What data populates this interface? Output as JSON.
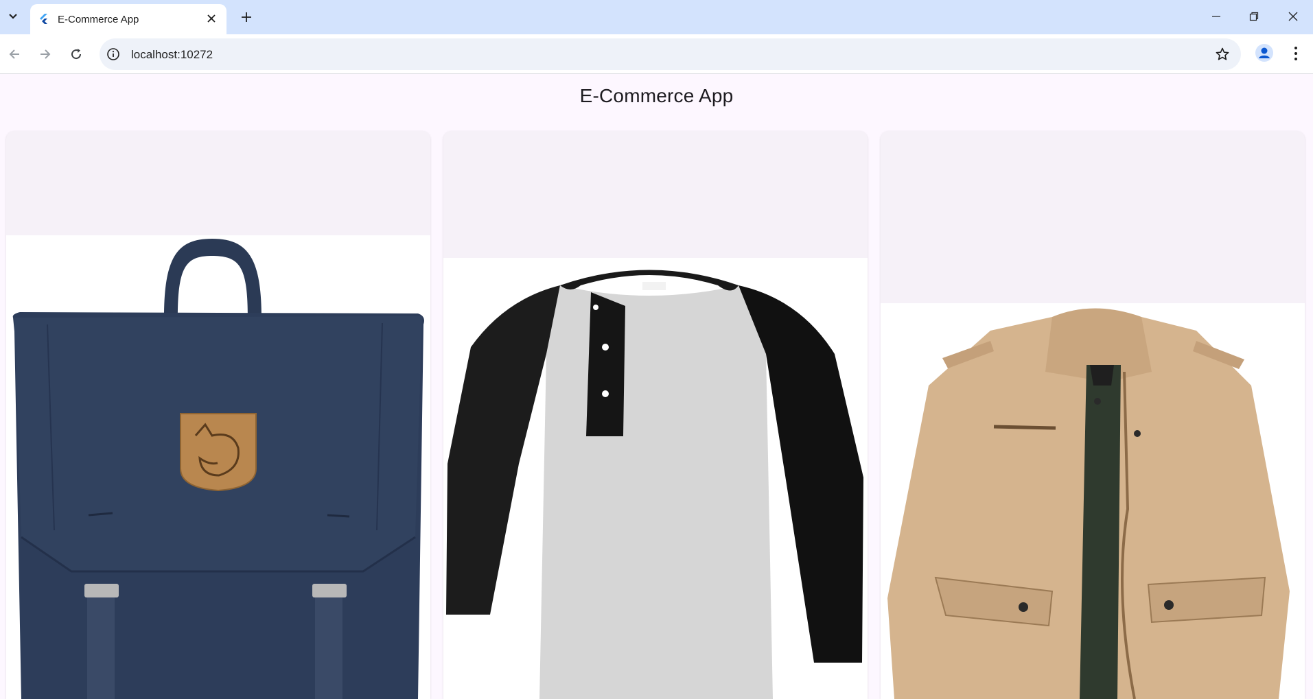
{
  "browser": {
    "tab_title": "E-Commerce App",
    "url": "localhost:10272"
  },
  "app": {
    "title": "E-Commerce App"
  },
  "products": [
    {
      "name": "backpack",
      "icon": "backpack-image"
    },
    {
      "name": "raglan-henley-shirt",
      "icon": "shirt-image"
    },
    {
      "name": "khaki-jacket",
      "icon": "jacket-image"
    }
  ],
  "colors": {
    "tabbar": "#d3e3fd",
    "page_bg": "#fdf7ff",
    "card_bg": "#f6f1f8",
    "backpack": "#2b3a55",
    "jacket": "#d6b48f"
  }
}
